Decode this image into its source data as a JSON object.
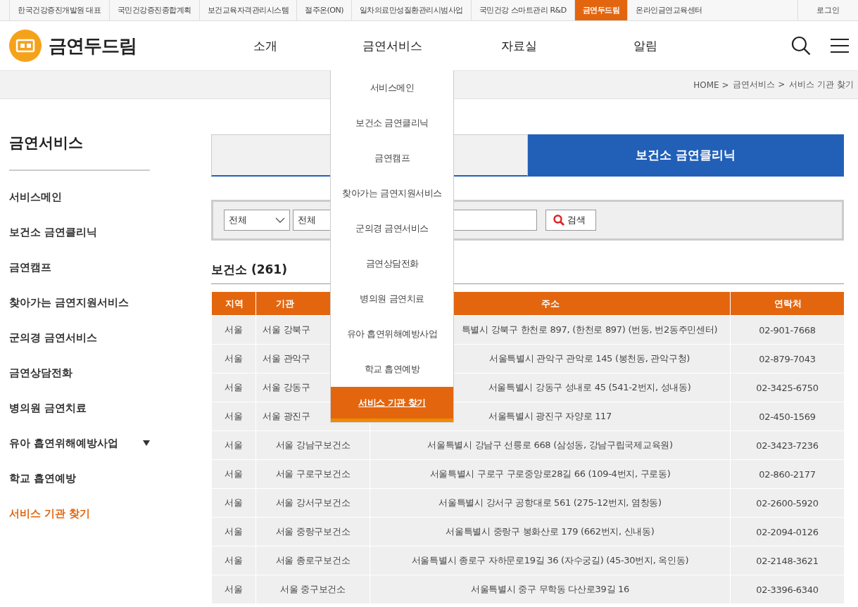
{
  "top_links": [
    {
      "label": "한국건강증진개발원 대표",
      "selected": false
    },
    {
      "label": "국민건강증진종합계획",
      "selected": false
    },
    {
      "label": "보건교육자격관리시스템",
      "selected": false
    },
    {
      "label": "절주온(ON)",
      "selected": false
    },
    {
      "label": "일차의료만성질환관리시범사업",
      "selected": false
    },
    {
      "label": "국민건강 스마트관리 R&D",
      "selected": false
    },
    {
      "label": "금연두드림",
      "selected": true
    },
    {
      "label": "온라인금연교육센터",
      "selected": false
    }
  ],
  "login": "로그인",
  "logo": "금연두드림",
  "nav": [
    {
      "label": "소개"
    },
    {
      "label": "금연서비스",
      "menu": [
        {
          "label": "서비스메인",
          "selected": false
        },
        {
          "label": "보건소 금연클리닉",
          "selected": false
        },
        {
          "label": "금연캠프",
          "selected": false
        },
        {
          "label": "찾아가는 금연지원서비스",
          "selected": false
        },
        {
          "label": "군의경 금연서비스",
          "selected": false
        },
        {
          "label": "금연상담전화",
          "selected": false
        },
        {
          "label": "병의원 금연치료",
          "selected": false
        },
        {
          "label": "유아 흡연위해예방사업",
          "selected": false
        },
        {
          "label": "학교 흡연예방",
          "selected": false
        },
        {
          "label": "서비스 기관 찾기",
          "selected": true
        }
      ]
    },
    {
      "label": "자료실"
    },
    {
      "label": "알림"
    }
  ],
  "breadcrumb": [
    "HOME >",
    "금연서비스 >",
    "서비스 기관 찾기"
  ],
  "sidebar": {
    "title": "금연서비스",
    "items": [
      {
        "label": "서비스메인",
        "selected": false
      },
      {
        "label": "보건소 금연클리닉",
        "selected": false
      },
      {
        "label": "금연캠프",
        "selected": false
      },
      {
        "label": "찾아가는 금연지원서비스",
        "selected": false
      },
      {
        "label": "군의경 금연서비스",
        "selected": false
      },
      {
        "label": "금연상담전화",
        "selected": false
      },
      {
        "label": "병의원 금연치료",
        "selected": false
      },
      {
        "label": "유아 흡연위해예방사업",
        "selected": false,
        "expanded": false
      },
      {
        "label": "학교 흡연예방",
        "selected": false
      },
      {
        "label": "서비스 기관 찾기",
        "selected": true
      }
    ]
  },
  "tabs": [
    {
      "selected": false
    },
    {
      "label": "보건소 금연클리닉",
      "selected": true
    }
  ],
  "search": {
    "select_1": "전체",
    "select_2": "전체",
    "button": "검색"
  },
  "result_title": "보건소 (261)",
  "table": {
    "columns": [
      "지역",
      "기관",
      "주소",
      "연락처"
    ],
    "rows": [
      [
        "서울",
        "서울 강북구",
        "특별시 강북구 한천로 897, (한천로 897) (번동, 번2동주민센터)",
        "02-901-7668"
      ],
      [
        "서울",
        "서울 관악구",
        "서울특별시 관악구 관악로 145 (봉천동, 관악구청)",
        "02-879-7043"
      ],
      [
        "서울",
        "서울 강동구",
        "서울특별시 강동구 성내로 45 (541-2번지, 성내동)",
        "02-3425-6750"
      ],
      [
        "서울",
        "서울 광진구",
        "서울특별시 광진구 자양로 117",
        "02-450-1569"
      ],
      [
        "서울",
        "서울 강남구보건소",
        "서울특별시 강남구 선릉로 668 (삼성동, 강남구립국제교육원)",
        "02-3423-7236"
      ],
      [
        "서울",
        "서울 구로구보건소",
        "서울특별시 구로구 구로중앙로28길 66 (109-4번지, 구로동)",
        "02-860-2177"
      ],
      [
        "서울",
        "서울 강서구보건소",
        "서울특별시 강서구 공항대로 561 (275-12번지, 염창동)",
        "02-2600-5920"
      ],
      [
        "서울",
        "서울 중랑구보건소",
        "서울특별시 중랑구 봉화산로 179 (662번지, 신내동)",
        "02-2094-0126"
      ],
      [
        "서울",
        "서울 종로구보건소",
        "서울특별시 종로구 자하문로19길 36 (자수궁길) (45-30번지, 옥인동)",
        "02-2148-3621"
      ],
      [
        "서울",
        "서울 중구보건소",
        "서울특별시 중구 무학동 다산로39길 16",
        "02-3396-6340"
      ]
    ]
  }
}
